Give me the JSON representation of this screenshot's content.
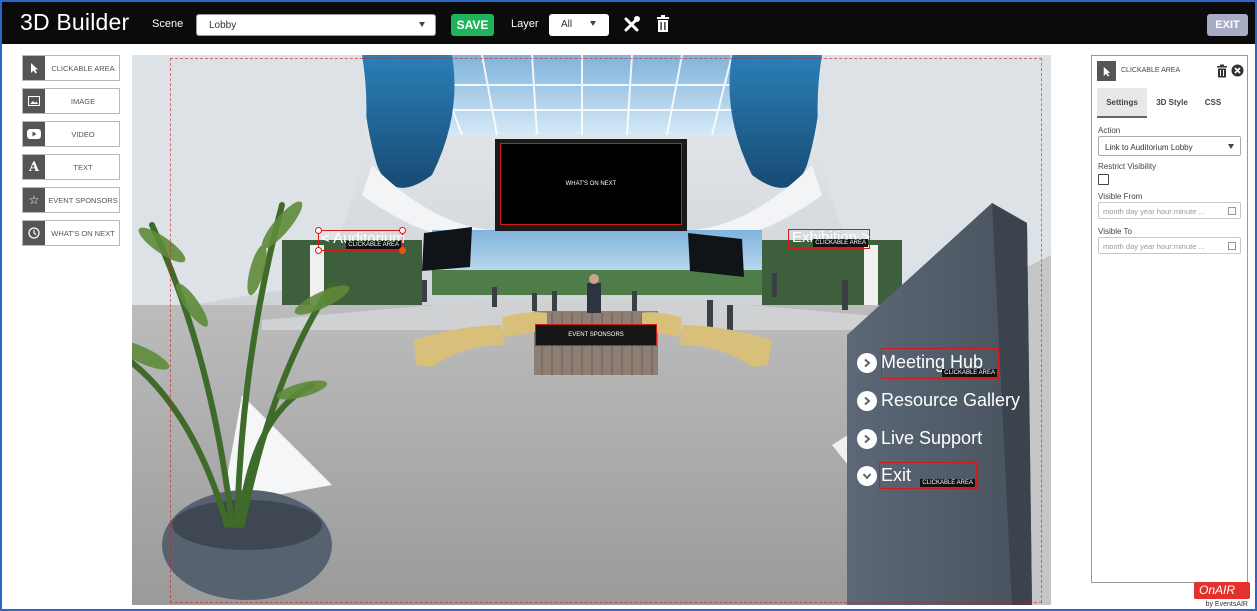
{
  "header": {
    "app_title": "3D Builder",
    "scene_label": "Scene",
    "scene_value": "Lobby",
    "save_label": "SAVE",
    "layer_label": "Layer",
    "layer_value": "All",
    "exit_label": "EXIT",
    "tools": [
      "tools-icon",
      "trash-icon"
    ]
  },
  "toolbox": {
    "items": [
      {
        "label": "CLICKABLE AREA",
        "icon": "cursor-icon"
      },
      {
        "label": "IMAGE",
        "icon": "image-icon"
      },
      {
        "label": "VIDEO",
        "icon": "video-icon"
      },
      {
        "label": "TEXT",
        "icon": "text-icon"
      },
      {
        "label": "EVENT SPONSORS",
        "icon": "sponsors-icon"
      },
      {
        "label": "WHAT'S ON NEXT",
        "icon": "clock-icon"
      }
    ]
  },
  "scene": {
    "whats_on_next": "WHAT'S ON NEXT",
    "event_sponsors": "EVENT SPONSORS",
    "left_sign": "< Auditorium",
    "right_sign": "Exhibition >",
    "clickable_tag": "CLICKABLE AREA",
    "menu": [
      "Meeting Hub",
      "Resource Gallery",
      "Live Support",
      "Exit"
    ]
  },
  "panel": {
    "title": "CLICKABLE AREA",
    "tabs": [
      "Settings",
      "3D Style",
      "CSS"
    ],
    "active_tab": "Settings",
    "action_label": "Action",
    "action_value": "Link to Auditorium Lobby",
    "restrict_label": "Restrict Visibility",
    "restrict_checked": false,
    "visible_from_label": "Visible From",
    "visible_to_label": "Visible To",
    "date_placeholder": "month day year hour:minute ..."
  },
  "branding": {
    "logo": "OnAIR",
    "by": "by EventsAIR"
  },
  "colors": {
    "save": "#1fb45b",
    "exit": "#a7abc4",
    "selection": "#d21a1a",
    "logo": "#e3312d"
  }
}
